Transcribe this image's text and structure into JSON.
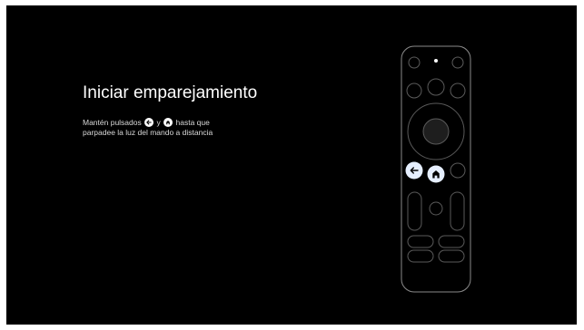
{
  "screen": {
    "background": "#000000",
    "accent_button": "#e6efff"
  },
  "pairing": {
    "title": "Iniciar emparejamiento",
    "instruction_part1": "Mantén pulsados",
    "instruction_joiner": "y",
    "instruction_part2": "hasta que",
    "instruction_line2": "parpadee la luz del mando a distancia",
    "inline_icons": [
      "back-icon",
      "home-icon"
    ]
  },
  "remote": {
    "highlighted_buttons": [
      "back-button",
      "home-button"
    ],
    "led_state": "on"
  }
}
